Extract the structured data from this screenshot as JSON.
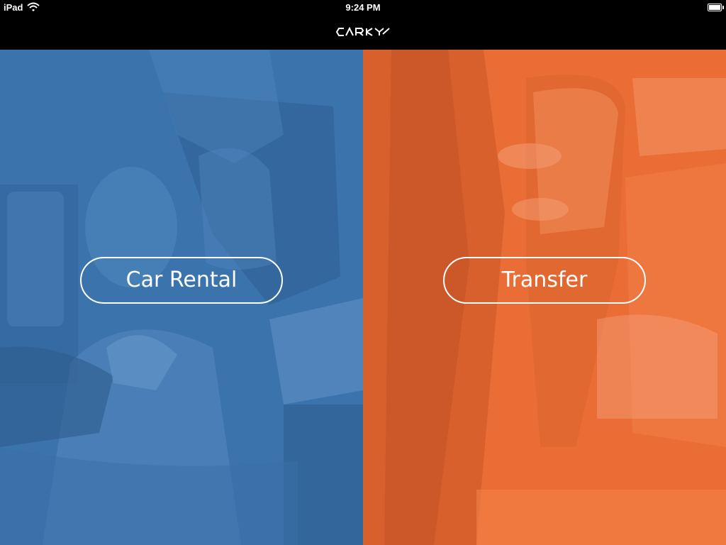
{
  "status_bar": {
    "device": "iPad",
    "time": "9:24 PM"
  },
  "brand": {
    "name": "CARKY",
    "logo_color": "#ffffff"
  },
  "panels": {
    "car_rental": {
      "label": "Car Rental",
      "overlay_color": "#3b73ad"
    },
    "transfer": {
      "label": "Transfer",
      "overlay_color": "#ea6d35"
    }
  },
  "icons": {
    "wifi": "wifi-icon",
    "battery": "battery-icon"
  }
}
